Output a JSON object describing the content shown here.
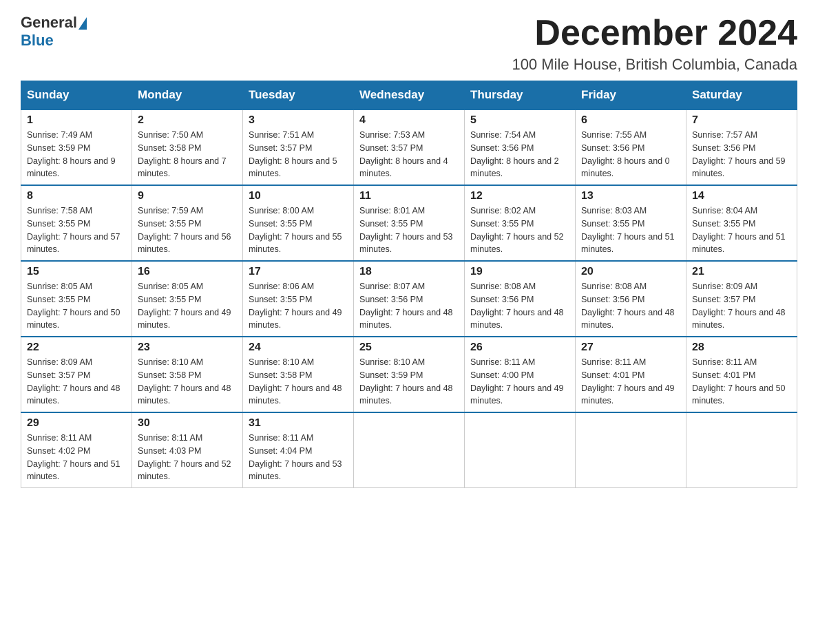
{
  "logo": {
    "general": "General",
    "blue": "Blue"
  },
  "header": {
    "month": "December 2024",
    "location": "100 Mile House, British Columbia, Canada"
  },
  "days_of_week": [
    "Sunday",
    "Monday",
    "Tuesday",
    "Wednesday",
    "Thursday",
    "Friday",
    "Saturday"
  ],
  "weeks": [
    [
      {
        "day": "1",
        "sunrise": "7:49 AM",
        "sunset": "3:59 PM",
        "daylight": "8 hours and 9 minutes."
      },
      {
        "day": "2",
        "sunrise": "7:50 AM",
        "sunset": "3:58 PM",
        "daylight": "8 hours and 7 minutes."
      },
      {
        "day": "3",
        "sunrise": "7:51 AM",
        "sunset": "3:57 PM",
        "daylight": "8 hours and 5 minutes."
      },
      {
        "day": "4",
        "sunrise": "7:53 AM",
        "sunset": "3:57 PM",
        "daylight": "8 hours and 4 minutes."
      },
      {
        "day": "5",
        "sunrise": "7:54 AM",
        "sunset": "3:56 PM",
        "daylight": "8 hours and 2 minutes."
      },
      {
        "day": "6",
        "sunrise": "7:55 AM",
        "sunset": "3:56 PM",
        "daylight": "8 hours and 0 minutes."
      },
      {
        "day": "7",
        "sunrise": "7:57 AM",
        "sunset": "3:56 PM",
        "daylight": "7 hours and 59 minutes."
      }
    ],
    [
      {
        "day": "8",
        "sunrise": "7:58 AM",
        "sunset": "3:55 PM",
        "daylight": "7 hours and 57 minutes."
      },
      {
        "day": "9",
        "sunrise": "7:59 AM",
        "sunset": "3:55 PM",
        "daylight": "7 hours and 56 minutes."
      },
      {
        "day": "10",
        "sunrise": "8:00 AM",
        "sunset": "3:55 PM",
        "daylight": "7 hours and 55 minutes."
      },
      {
        "day": "11",
        "sunrise": "8:01 AM",
        "sunset": "3:55 PM",
        "daylight": "7 hours and 53 minutes."
      },
      {
        "day": "12",
        "sunrise": "8:02 AM",
        "sunset": "3:55 PM",
        "daylight": "7 hours and 52 minutes."
      },
      {
        "day": "13",
        "sunrise": "8:03 AM",
        "sunset": "3:55 PM",
        "daylight": "7 hours and 51 minutes."
      },
      {
        "day": "14",
        "sunrise": "8:04 AM",
        "sunset": "3:55 PM",
        "daylight": "7 hours and 51 minutes."
      }
    ],
    [
      {
        "day": "15",
        "sunrise": "8:05 AM",
        "sunset": "3:55 PM",
        "daylight": "7 hours and 50 minutes."
      },
      {
        "day": "16",
        "sunrise": "8:05 AM",
        "sunset": "3:55 PM",
        "daylight": "7 hours and 49 minutes."
      },
      {
        "day": "17",
        "sunrise": "8:06 AM",
        "sunset": "3:55 PM",
        "daylight": "7 hours and 49 minutes."
      },
      {
        "day": "18",
        "sunrise": "8:07 AM",
        "sunset": "3:56 PM",
        "daylight": "7 hours and 48 minutes."
      },
      {
        "day": "19",
        "sunrise": "8:08 AM",
        "sunset": "3:56 PM",
        "daylight": "7 hours and 48 minutes."
      },
      {
        "day": "20",
        "sunrise": "8:08 AM",
        "sunset": "3:56 PM",
        "daylight": "7 hours and 48 minutes."
      },
      {
        "day": "21",
        "sunrise": "8:09 AM",
        "sunset": "3:57 PM",
        "daylight": "7 hours and 48 minutes."
      }
    ],
    [
      {
        "day": "22",
        "sunrise": "8:09 AM",
        "sunset": "3:57 PM",
        "daylight": "7 hours and 48 minutes."
      },
      {
        "day": "23",
        "sunrise": "8:10 AM",
        "sunset": "3:58 PM",
        "daylight": "7 hours and 48 minutes."
      },
      {
        "day": "24",
        "sunrise": "8:10 AM",
        "sunset": "3:58 PM",
        "daylight": "7 hours and 48 minutes."
      },
      {
        "day": "25",
        "sunrise": "8:10 AM",
        "sunset": "3:59 PM",
        "daylight": "7 hours and 48 minutes."
      },
      {
        "day": "26",
        "sunrise": "8:11 AM",
        "sunset": "4:00 PM",
        "daylight": "7 hours and 49 minutes."
      },
      {
        "day": "27",
        "sunrise": "8:11 AM",
        "sunset": "4:01 PM",
        "daylight": "7 hours and 49 minutes."
      },
      {
        "day": "28",
        "sunrise": "8:11 AM",
        "sunset": "4:01 PM",
        "daylight": "7 hours and 50 minutes."
      }
    ],
    [
      {
        "day": "29",
        "sunrise": "8:11 AM",
        "sunset": "4:02 PM",
        "daylight": "7 hours and 51 minutes."
      },
      {
        "day": "30",
        "sunrise": "8:11 AM",
        "sunset": "4:03 PM",
        "daylight": "7 hours and 52 minutes."
      },
      {
        "day": "31",
        "sunrise": "8:11 AM",
        "sunset": "4:04 PM",
        "daylight": "7 hours and 53 minutes."
      },
      null,
      null,
      null,
      null
    ]
  ]
}
